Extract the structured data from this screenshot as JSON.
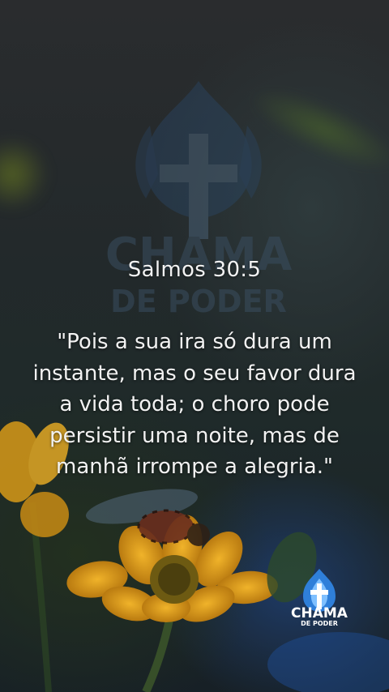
{
  "verse": {
    "reference": "Salmos 30:5",
    "text": "\"Pois a sua ira só dura um instante, mas o seu favor dura a vida toda; o choro pode persistir uma noite, mas de manhã irrompe a alegria.\""
  },
  "watermark": {
    "line1": "CHAMA",
    "line2": "DE PODER"
  },
  "logo": {
    "line1": "CHAMA",
    "line2": "DE PODER"
  },
  "colors": {
    "text": "#f2f2f2",
    "flower": "#e0a21a",
    "flame": "#2f7fd9"
  },
  "icons": [
    "flame-cross-watermark-icon",
    "flame-cross-logo-icon"
  ]
}
